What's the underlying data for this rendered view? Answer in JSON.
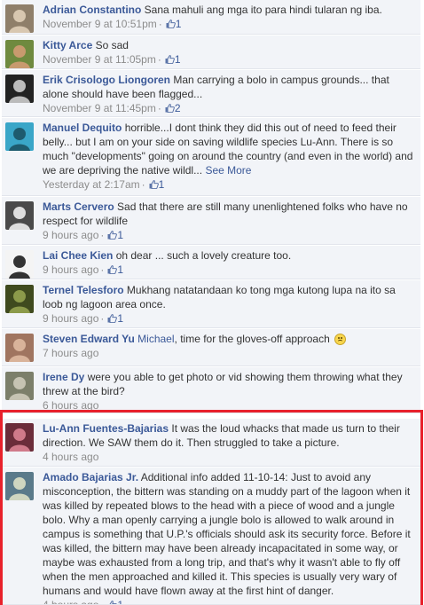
{
  "comments": [
    {
      "author": "Adrian Constantino",
      "text": "Sana mahuli ang mga ito para hindi tularan ng iba.",
      "time": "November 9 at 10:51pm",
      "likes": "1",
      "avatar_colors": [
        "#8f7f6a",
        "#d8c7b0"
      ]
    },
    {
      "author": "Kitty Arce",
      "text": "So sad",
      "time": "November 9 at 11:05pm",
      "likes": "1",
      "avatar_colors": [
        "#6f8a3f",
        "#c89a6e"
      ]
    },
    {
      "author": "Erik Crisologo Liongoren",
      "text": "Man carrying a bolo in campus grounds... that alone should have been flagged...",
      "time": "November 9 at 11:45pm",
      "likes": "2",
      "avatar_colors": [
        "#222222",
        "#bbbbbb"
      ]
    },
    {
      "author": "Manuel Dequito",
      "text": "horrible...I dont think they did this out of need to feed their belly... but I am on your side on saving wildlife species Lu-Ann. There is so much \"developments\" going on around the country (and even in the world) and we are depriving the native wildl...",
      "see_more": "See More",
      "time": "Yesterday at 2:17am",
      "likes": "1",
      "avatar_colors": [
        "#3aa6c8",
        "#1e5b6e"
      ]
    },
    {
      "author": "Marts Cervero",
      "text": "Sad that there are still many unenlightened folks who have no respect for wildlife",
      "time": "9 hours ago",
      "likes": "1",
      "avatar_colors": [
        "#4a4a4a",
        "#dddddd"
      ]
    },
    {
      "author": "Lai Chee Kien",
      "text": "oh dear ... such a lovely creature too.",
      "time": "9 hours ago",
      "likes": "1",
      "avatar_colors": [
        "#f4f4f4",
        "#333333"
      ]
    },
    {
      "author": "Ternel Telesforo",
      "text": "Mukhang natatandaan ko tong mga kutong lupa na ito sa loob ng lagoon area once.",
      "time": "9 hours ago",
      "likes": "1",
      "avatar_colors": [
        "#3f4a1e",
        "#8c9a4a"
      ]
    },
    {
      "author": "Steven Edward Yu",
      "mention": "Michael",
      "text": ", time for the gloves-off approach",
      "time": "7 hours ago",
      "likes": "",
      "avatar_colors": [
        "#a07560",
        "#d9b39a"
      ]
    },
    {
      "author": "Irene Dy",
      "text": "were you able to get photo or vid showing them throwing what they threw at the bird?",
      "time": "6 hours ago",
      "likes": "",
      "avatar_colors": [
        "#7c7f6a",
        "#c6c3b2"
      ]
    },
    {
      "author": "Lu-Ann Fuentes-Bajarias",
      "text": "It was the loud whacks that made us turn to their direction. We SAW them do it. Then struggled to take a picture.",
      "time": "4 hours ago",
      "likes": "",
      "avatar_colors": [
        "#6b2d3a",
        "#d07a8a"
      ]
    },
    {
      "author": "Amado Bajarias Jr.",
      "text": "Additional info added 11-10-14: Just to avoid any misconception, the bittern was standing on a muddy part of the lagoon when it was killed by repeated blows to the head with a piece of wood and a jungle bolo. Why a man openly carrying a jungle bolo is allowed to walk around in campus is something that U.P.'s officials should ask its security force. Before it was killed, the bittern may have been already incapacitated in some way, or maybe was exhausted from a long trip, and that's why it wasn't able to fly off when the men approached and killed it. This species is usually very wary of humans and would have flown away at the first hint of danger.",
      "time": "4 hours ago",
      "likes": "1",
      "avatar_colors": [
        "#5a7a8a",
        "#cfd6c0"
      ]
    }
  ],
  "colors": {
    "link": "#3b5998",
    "meta": "#8c8c8c",
    "highlight": "#e8212b",
    "row_bg": "#f2f4f8"
  },
  "icons": {
    "like": "thumbs-up-icon",
    "emoji": "frown-emoji-icon"
  }
}
